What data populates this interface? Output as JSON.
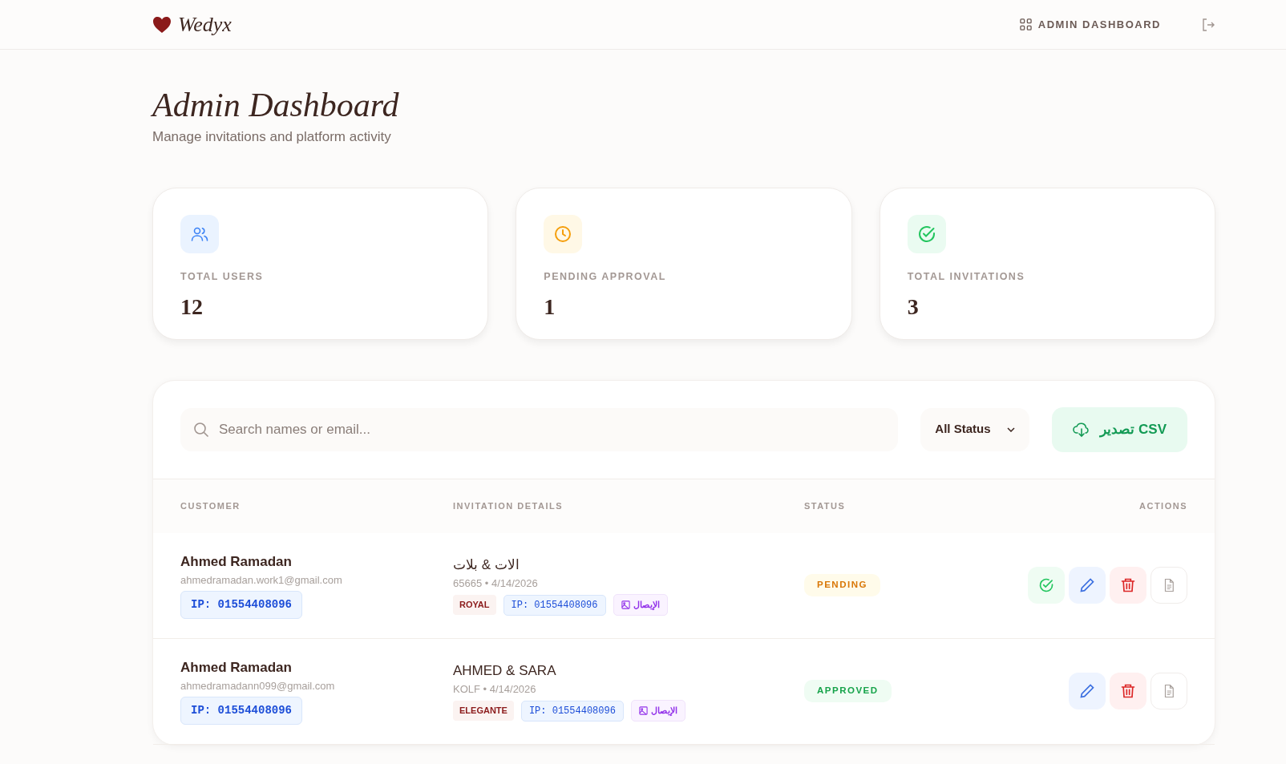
{
  "brand": "Wedyx",
  "nav": {
    "label": "ADMIN DASHBOARD"
  },
  "page": {
    "title": "Admin Dashboard",
    "subtitle": "Manage invitations and platform activity"
  },
  "stats": [
    {
      "kind": "users",
      "label": "TOTAL USERS",
      "value": "12"
    },
    {
      "kind": "pending",
      "label": "PENDING APPROVAL",
      "value": "1"
    },
    {
      "kind": "invitations",
      "label": "TOTAL INVITATIONS",
      "value": "3"
    }
  ],
  "search": {
    "placeholder": "Search names or email..."
  },
  "status_filter": "All Status",
  "export_button": "تصدير CSV",
  "table": {
    "columns": [
      "CUSTOMER",
      "INVITATION DETAILS",
      "STATUS",
      "ACTIONS"
    ],
    "rows": [
      {
        "name": "Ahmed Ramadan",
        "email": "ahmedramadan.work1@gmail.com",
        "ip": "IP: 01554408096",
        "couple": "الات & بلات",
        "meta": "65665 • 4/14/2026",
        "template": "ROYAL",
        "invite_ip": "IP: 01554408096",
        "receipt": "الإيصال",
        "status": {
          "kind": "pending",
          "label": "PENDING"
        },
        "can_approve": true
      },
      {
        "name": "Ahmed Ramadan",
        "email": "ahmedramadann099@gmail.com",
        "ip": "IP: 01554408096",
        "couple": "AHMED & SARA",
        "meta": "KOLF • 4/14/2026",
        "template": "ELEGANTE",
        "invite_ip": "IP: 01554408096",
        "receipt": "الإيصال",
        "status": {
          "kind": "approved",
          "label": "APPROVED"
        },
        "can_approve": false
      }
    ]
  }
}
